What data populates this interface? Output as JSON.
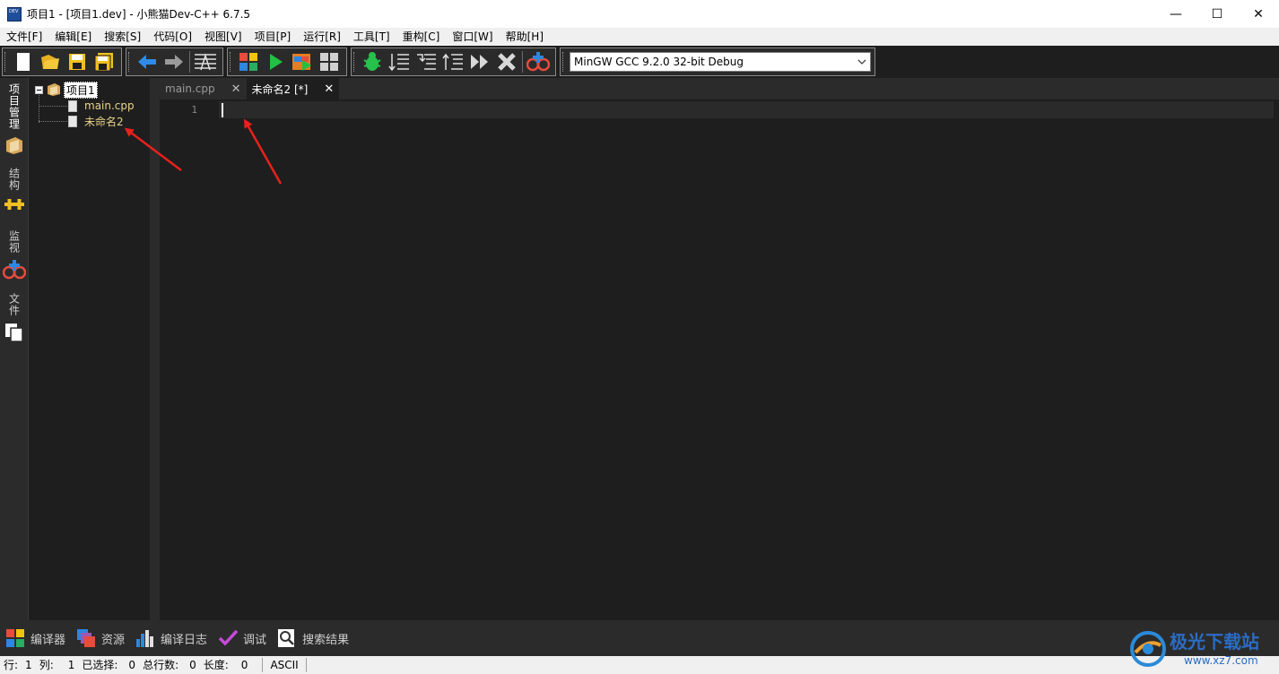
{
  "window": {
    "title": "项目1 - [项目1.dev] - 小熊猫Dev-C++ 6.7.5",
    "minimize": "—",
    "maximize": "☐",
    "close": "✕"
  },
  "menu": [
    "文件[F]",
    "编辑[E]",
    "搜索[S]",
    "代码[O]",
    "视图[V]",
    "项目[P]",
    "运行[R]",
    "工具[T]",
    "重构[C]",
    "窗口[W]",
    "帮助[H]"
  ],
  "toolbar": {
    "compiler": "MinGW GCC 9.2.0 32-bit Debug"
  },
  "left_tabs": {
    "project": "项目管理",
    "structure": "结构",
    "watch": "监视",
    "files": "文件"
  },
  "tree": {
    "root": "项目1",
    "files": [
      "main.cpp",
      "未命名2"
    ]
  },
  "tabs": [
    {
      "label": "main.cpp",
      "close": "✕"
    },
    {
      "label": "未命名2 [*]",
      "close": "✕"
    }
  ],
  "editor": {
    "line_number": "1"
  },
  "bottom_tabs": {
    "compiler": "编译器",
    "resources": "资源",
    "compile_log": "编译日志",
    "debug": "调试",
    "search_results": "搜索结果"
  },
  "status": {
    "row_label": "行:",
    "row_value": "1",
    "col_label": "列:",
    "col_value": "1",
    "selected_label": "已选择:",
    "selected_value": "0",
    "total_lines_label": "总行数:",
    "total_lines_value": "0",
    "length_label": "长度:",
    "length_value": "0",
    "encoding": "ASCII"
  },
  "watermark": {
    "name": "极光下载站",
    "url": "www.xz7.com"
  },
  "colors": {
    "annotation_arrow": "#e8211c",
    "tree_file_text": "#e8d38a",
    "editor_bg": "#1e1e1e"
  }
}
